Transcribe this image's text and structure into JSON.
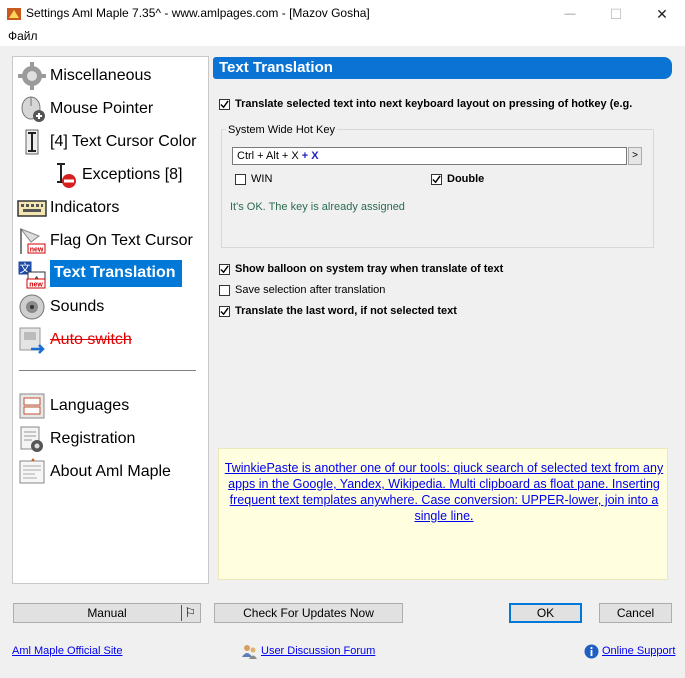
{
  "window": {
    "title": "Settings Aml Maple 7.35^ - www.amlpages.com - [Mazov Gosha]",
    "minimize_glyph": "—",
    "maximize_glyph": "☐",
    "close_glyph": "✕"
  },
  "menu": {
    "file": "Файл"
  },
  "sidebar": {
    "items": [
      {
        "label": "Miscellaneous",
        "icon": "gear-icon"
      },
      {
        "label": "Mouse Pointer",
        "icon": "mouse-icon"
      },
      {
        "label": "[4] Text Cursor Color",
        "icon": "text-cursor-icon"
      },
      {
        "label": "Exceptions [8]",
        "icon": "cursor-exception-icon"
      },
      {
        "label": "Indicators",
        "icon": "keyboard-icon"
      },
      {
        "label": "Flag On Text Cursor",
        "icon": "flag-icon"
      },
      {
        "label": "Text Translation",
        "icon": "translate-icon"
      },
      {
        "label": "Sounds",
        "icon": "speaker-icon"
      },
      {
        "label": "Auto switch",
        "icon": "auto-switch-icon"
      }
    ],
    "bottom_items": [
      {
        "label": "Languages",
        "icon": "languages-icon"
      },
      {
        "label": "Registration",
        "icon": "registration-icon"
      },
      {
        "label": "About Aml Maple",
        "icon": "about-icon"
      }
    ],
    "new_badge": "new"
  },
  "panel": {
    "title": "Text Translation",
    "translate_selected": {
      "label": "Translate selected text into next keyboard layout on pressing of hotkey (e.g.",
      "checked": true
    },
    "hotkey_group": {
      "title": "System Wide Hot Key",
      "hotkey_prefix": "Ctrl + Alt + X",
      "hotkey_suffix": " + X",
      "more_button": ">",
      "win": {
        "label": "WIN",
        "checked": false
      },
      "double": {
        "label": "Double",
        "checked": true
      },
      "status": "It's OK. The key is already assigned"
    },
    "show_balloon": {
      "label": "Show balloon on system tray when translate of text",
      "checked": true
    },
    "save_selection": {
      "label": "Save selection after translation",
      "checked": false
    },
    "translate_last_word": {
      "label": "Translate the last word, if not selected text",
      "checked": true
    },
    "promo_text": "TwinkiePaste is another one of our tools: qiuck search of selected text from any apps in the Google, Yandex, Wikipedia. Multi clipboard as float pane. Inserting frequent text templates anywhere. Case conversion: UPPER-lower, join into a single line."
  },
  "buttons": {
    "manual": "Manual",
    "manual_icon": "⚐",
    "check_updates": "Check For Updates Now",
    "ok": "OK",
    "cancel": "Cancel"
  },
  "footer": {
    "official_site": "Aml Maple Official Site",
    "forum": "User Discussion Forum",
    "support": "Online Support"
  },
  "colors": {
    "accent": "#0078d7",
    "header": "#0a73d4",
    "promo_bg": "#ffffe0",
    "status_ok": "#2b6b4f",
    "disabled_red": "#e00000"
  }
}
